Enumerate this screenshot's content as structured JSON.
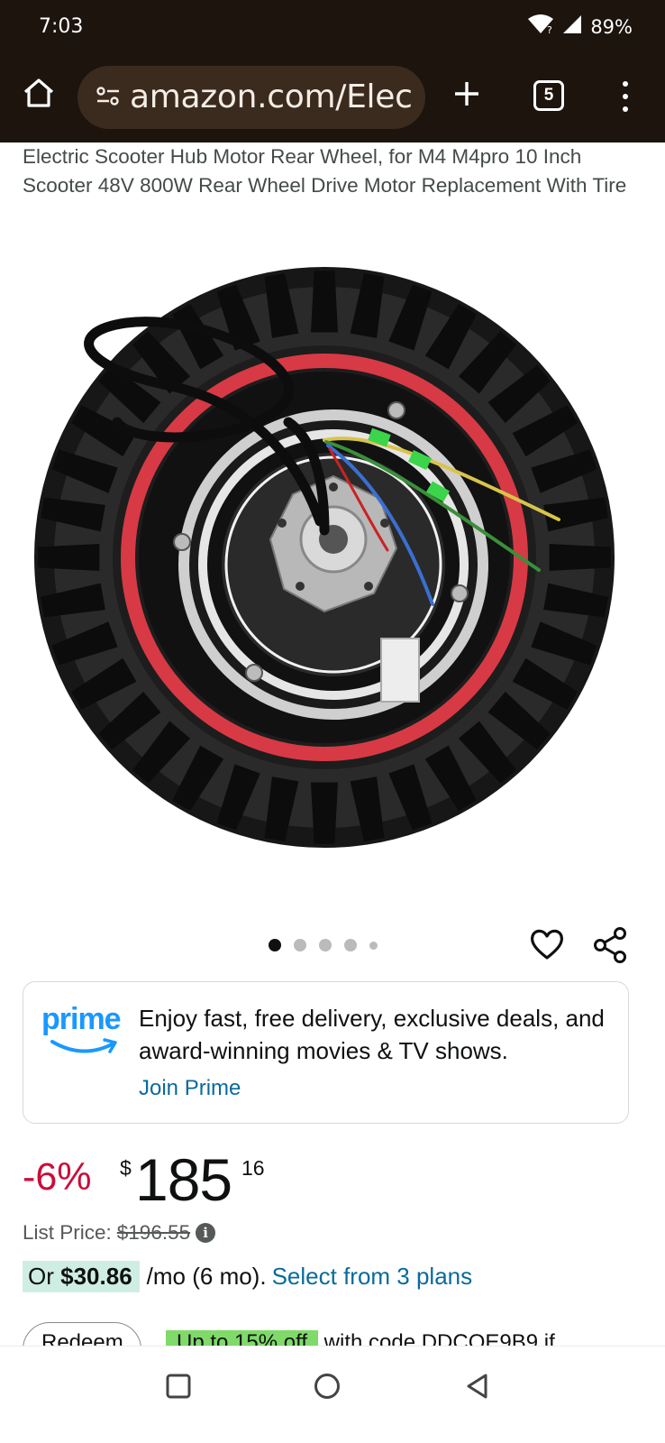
{
  "status_bar": {
    "time": "7:03",
    "battery": "89%",
    "icons": [
      "wifi-icon",
      "signal-icon"
    ]
  },
  "browser": {
    "url": "amazon.com/Elec",
    "tab_count": "5",
    "icons": [
      "home-icon",
      "site-settings-icon",
      "new-tab-icon",
      "overflow-menu-icon"
    ]
  },
  "product": {
    "title": "Electric Scooter Hub Motor Rear Wheel, for M4 M4pro 10 Inch Scooter 48V 800W Rear Wheel Drive Motor Replacement With Tire",
    "image_alt": "Electric scooter hub motor rear wheel with knobby tire and red rim",
    "carousel_total": 5,
    "carousel_active": 1
  },
  "prime": {
    "logo_text": "prime",
    "pitch": "Enjoy fast, free delivery, exclusive deals, and award-winning movies & TV shows.",
    "cta": "Join Prime"
  },
  "price": {
    "discount": "-6%",
    "symbol": "$",
    "whole": "185",
    "fraction": "16",
    "list_label": "List Price:",
    "list_value": "$196.55",
    "monthly_prefix": "Or",
    "monthly_amount": "$30.86",
    "monthly_suffix": "/mo (6 mo).",
    "monthly_link": "Select from 3 plans"
  },
  "partial": {
    "button_label": "Redeem",
    "coupon_badge": "Up to 15% off",
    "coupon_text": "with code DDCOE9B9 if"
  },
  "colors": {
    "browser_bg": "#1c140d",
    "url_pill": "#3a2b1e",
    "prime_blue": "#1a98ff",
    "link_blue": "#0a6a9c",
    "discount_red": "#cc0c39",
    "monthly_highlight": "#cfeee3",
    "coupon_green": "#7fda69"
  }
}
